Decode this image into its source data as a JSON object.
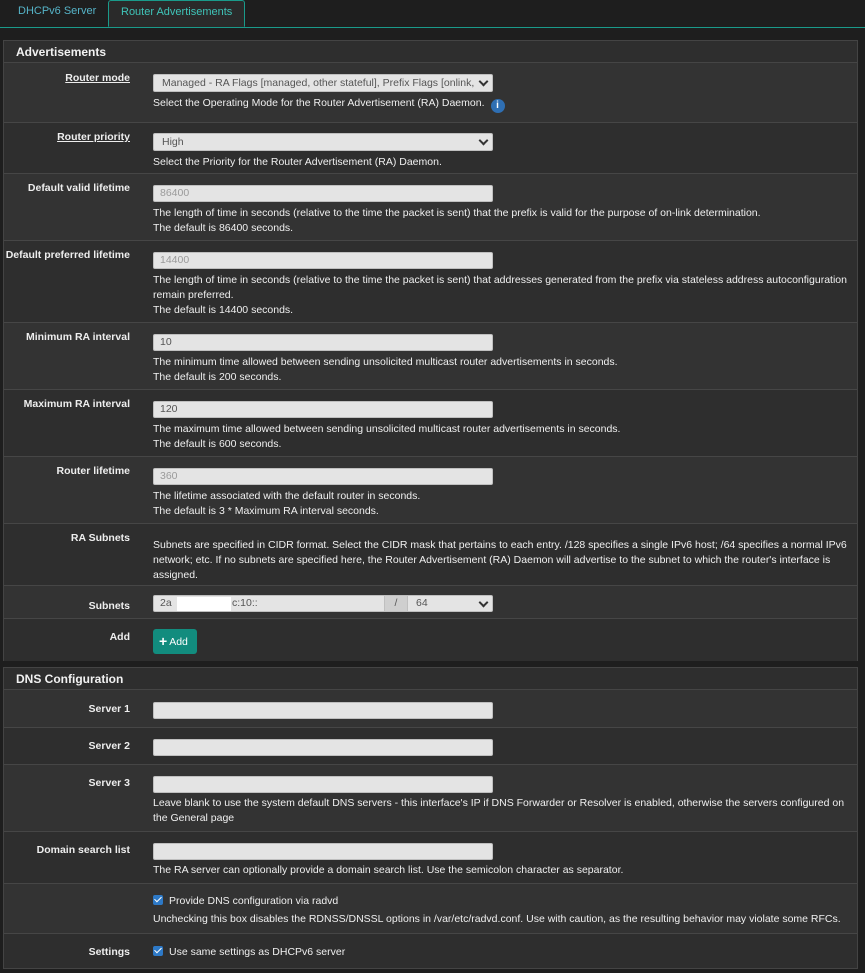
{
  "tabs": [
    {
      "label": "DHCPv6 Server"
    },
    {
      "label": "Router Advertisements"
    }
  ],
  "advertisements": {
    "title": "Advertisements",
    "router_mode": {
      "label": "Router mode",
      "value": "Managed - RA Flags [managed, other stateful], Prefix Flags [onlink,",
      "help": "Select the Operating Mode for the Router Advertisement (RA) Daemon."
    },
    "router_priority": {
      "label": "Router priority",
      "value": "High",
      "help": "Select the Priority for the Router Advertisement (RA) Daemon."
    },
    "default_valid_lifetime": {
      "label": "Default valid lifetime",
      "placeholder": "86400",
      "help1": "The length of time in seconds (relative to the time the packet is sent) that the prefix is valid for the purpose of on-link determination.",
      "help2": "The default is 86400 seconds."
    },
    "default_preferred_lifetime": {
      "label": "Default preferred lifetime",
      "placeholder": "14400",
      "help1": "The length of time in seconds (relative to the time the packet is sent) that addresses generated from the prefix via stateless address autoconfiguration remain preferred.",
      "help2": "The default is 14400 seconds."
    },
    "min_ra_interval": {
      "label": "Minimum RA interval",
      "value": "10",
      "help1": "The minimum time allowed between sending unsolicited multicast router advertisements in seconds.",
      "help2": "The default is 200 seconds."
    },
    "max_ra_interval": {
      "label": "Maximum RA interval",
      "value": "120",
      "help1": "The maximum time allowed between sending unsolicited multicast router advertisements in seconds.",
      "help2": "The default is 600 seconds."
    },
    "router_lifetime": {
      "label": "Router lifetime",
      "placeholder": "360",
      "help1": "The lifetime associated with the default router in seconds.",
      "help2": "The default is 3 * Maximum RA interval seconds."
    },
    "ra_subnets": {
      "label": "RA Subnets",
      "help": "Subnets are specified in CIDR format. Select the CIDR mask that pertains to each entry. /128 specifies a single IPv6 host; /64 specifies a normal IPv6 network; etc. If no subnets are specified here, the Router Advertisement (RA) Daemon will advertise to the subnet to which the router's interface is assigned."
    },
    "subnets": {
      "label": "Subnets",
      "address_prefix": "2a",
      "address_suffix": "c:10::",
      "slash": "/",
      "mask": "64"
    },
    "add": {
      "label": "Add",
      "button": "Add"
    }
  },
  "dns": {
    "title": "DNS Configuration",
    "server1": {
      "label": "Server 1",
      "value": ""
    },
    "server2": {
      "label": "Server 2",
      "value": ""
    },
    "server3": {
      "label": "Server 3",
      "value": "",
      "help": "Leave blank to use the system default DNS servers - this interface's IP if DNS Forwarder or Resolver is enabled, otherwise the servers configured on the General page"
    },
    "domain_search": {
      "label": "Domain search list",
      "value": "",
      "help": "The RA server can optionally provide a domain search list. Use the semicolon character as separator."
    },
    "radvd": {
      "checkbox_label": "Provide DNS configuration via radvd",
      "checked": true,
      "help": "Unchecking this box disables the RDNSS/DNSSL options in /var/etc/radvd.conf. Use with caution, as the resulting behavior may violate some RFCs."
    },
    "settings": {
      "label": "Settings",
      "checkbox_label": "Use same settings as DHCPv6 server",
      "checked": true
    }
  },
  "colors": {
    "accent": "#1a9a8a",
    "button": "#128c7e",
    "info": "#2f6fb3",
    "checkbox": "#2d79c7"
  }
}
